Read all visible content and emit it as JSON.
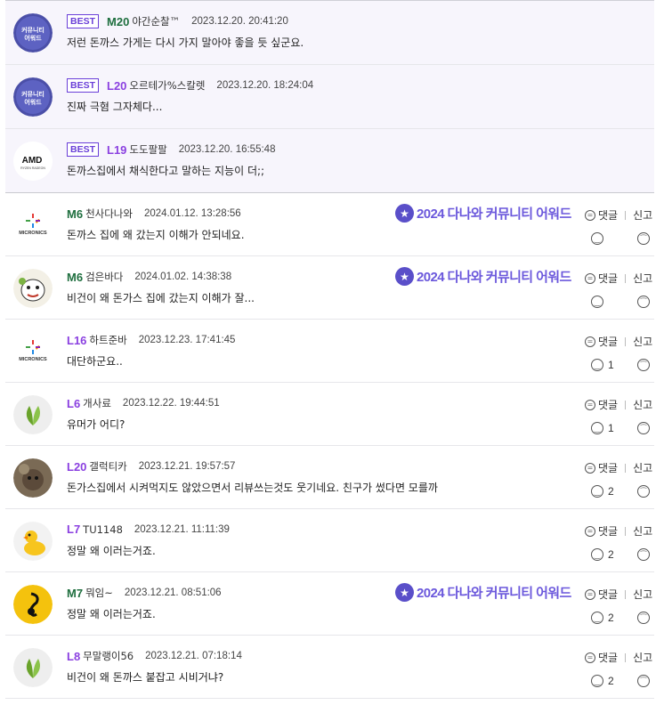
{
  "best_label": "BEST",
  "award_text": "2024 다나와 커뮤니티 어워드",
  "reply_label": "댓글",
  "report_label": "신고",
  "colors": {
    "best_bg": "#f7f5fc",
    "best_border": "#6a3fd8",
    "level_m": "#1f6f3f",
    "level_l": "#8a3fe0",
    "award": "#6b58dc"
  },
  "best_comments": [
    {
      "avatar": "award-badge",
      "level": "M20",
      "level_type": "m",
      "nick": "야간순찰™",
      "date": "2023.12.20. 20:41:20",
      "text": "저런 돈까스 가게는 다시 가지 말아야 좋을 듯 싶군요."
    },
    {
      "avatar": "award-badge",
      "level": "L20",
      "level_type": "l",
      "nick": "오르테가%스칼렛",
      "date": "2023.12.20. 18:24:04",
      "text": "진짜 극혐 그자체다..."
    },
    {
      "avatar": "amd-logo",
      "level": "L19",
      "level_type": "l",
      "nick": "도도팔팔",
      "date": "2023.12.20. 16:55:48",
      "text": "돈까스집에서 채식한다고 말하는 지능이 더;;"
    }
  ],
  "comments": [
    {
      "avatar": "micronics-logo",
      "level": "M6",
      "level_type": "m",
      "nick": "천사다나와",
      "date": "2024.01.12. 13:28:56",
      "text": "돈까스 집에 왜 갔는지 이해가 안되네요.",
      "award": true,
      "likes": ""
    },
    {
      "avatar": "cartoon-avatar",
      "level": "M6",
      "level_type": "m",
      "nick": "검은바다",
      "date": "2024.01.02. 14:38:38",
      "text": "비건이 왜 돈가스 집에 갔는지 이해가 잘...",
      "award": true,
      "likes": ""
    },
    {
      "avatar": "micronics-logo",
      "level": "L16",
      "level_type": "l",
      "nick": "하트준바",
      "date": "2023.12.23. 17:41:45",
      "text": "대단하군요..",
      "award": false,
      "likes": "1"
    },
    {
      "avatar": "leaf",
      "level": "L6",
      "level_type": "l",
      "nick": "개사료",
      "date": "2023.12.22. 19:44:51",
      "text": "유머가 어디?",
      "award": false,
      "likes": "1"
    },
    {
      "avatar": "animal-photo",
      "level": "L20",
      "level_type": "l",
      "nick": "갤럭티카",
      "date": "2023.12.21. 19:57:57",
      "text": "돈가스집에서 시켜먹지도 않았으면서 리뷰쓰는것도 웃기네요. 친구가 썼다면 모를까",
      "award": false,
      "likes": "2"
    },
    {
      "avatar": "duck",
      "level": "L7",
      "level_type": "l",
      "nick": "TU1148",
      "date": "2023.12.21. 11:11:39",
      "text": "정말 왜 이러는거죠.",
      "award": false,
      "likes": "2"
    },
    {
      "avatar": "music-note",
      "level": "M7",
      "level_type": "m",
      "nick": "뭐임~",
      "date": "2023.12.21. 08:51:06",
      "text": "정말 왜 이러는거죠.",
      "award": true,
      "likes": "2"
    },
    {
      "avatar": "leaf",
      "level": "L8",
      "level_type": "l",
      "nick": "무말랭이56",
      "date": "2023.12.21. 07:18:14",
      "text": "비건이 왜 돈까스 붙잡고 시비거냐?",
      "award": false,
      "likes": "2"
    }
  ]
}
